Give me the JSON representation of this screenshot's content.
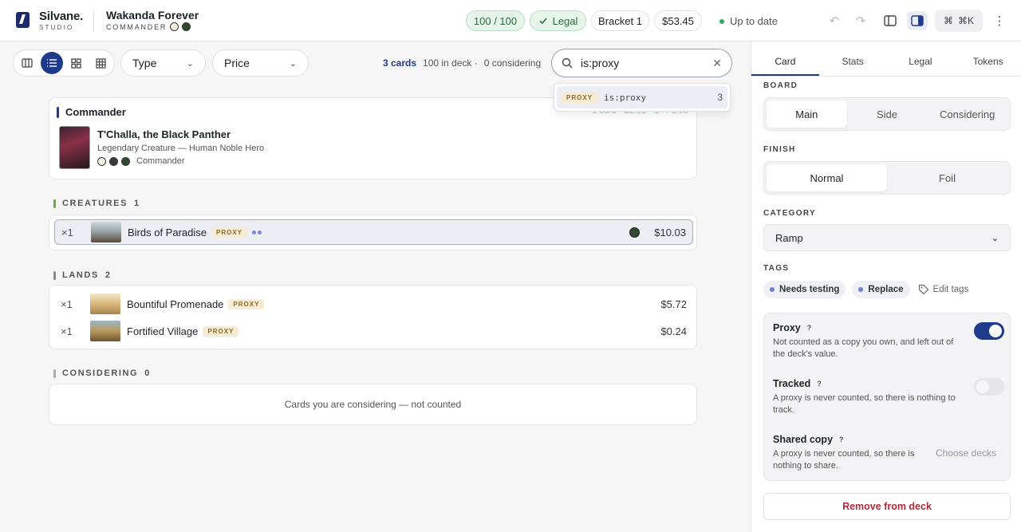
{
  "brand": {
    "name": "Silvane.",
    "sub": "STUDIO"
  },
  "deck": {
    "title": "Wakanda Forever",
    "format": "COMMANDER"
  },
  "header": {
    "count": "100 / 100",
    "legal": "Legal",
    "bracket": "Bracket 1",
    "price": "$53.45",
    "status": "Up to date",
    "shortcut": "⌘K"
  },
  "toolbar": {
    "type_label": "Type",
    "price_label": "Price",
    "cards_count": "3 cards",
    "in_deck": "100 in deck ·",
    "considering": "0 considering"
  },
  "search": {
    "value": "is:proxy",
    "suggestion": {
      "tag": "PROXY",
      "query": "is:proxy",
      "count": "3"
    }
  },
  "commander": {
    "heading": "Commander",
    "name": "T'Challa, the Black Panther",
    "type": "Legendary Creature — Human Noble Hero",
    "role": "Commander",
    "stats": "1 card · $2.01 · 1× / 1.00"
  },
  "sections": {
    "creatures": {
      "label": "CREATURES",
      "count": "1"
    },
    "lands": {
      "label": "LANDS",
      "count": "2"
    },
    "considering": {
      "label": "CONSIDERING",
      "count": "0",
      "empty": "Cards you are considering — not counted"
    }
  },
  "cards": {
    "creatures": [
      {
        "qty": "×1",
        "name": "Birds of Paradise",
        "tag": "PROXY",
        "price": "$10.03"
      }
    ],
    "lands": [
      {
        "qty": "×1",
        "name": "Bountiful Promenade",
        "tag": "PROXY",
        "price": "$5.72"
      },
      {
        "qty": "×1",
        "name": "Fortified Village",
        "tag": "PROXY",
        "price": "$0.24"
      }
    ]
  },
  "panel": {
    "tabs": [
      "Card",
      "Stats",
      "Legal",
      "Tokens"
    ],
    "board_label": "BOARD",
    "board_options": [
      "Main",
      "Side",
      "Considering"
    ],
    "finish_label": "FINISH",
    "finish_options": [
      "Normal",
      "Foil"
    ],
    "category_label": "CATEGORY",
    "category_value": "Ramp",
    "tags_label": "TAGS",
    "tags": [
      "Needs testing",
      "Replace"
    ],
    "edit_tags": "Edit tags",
    "proxy": {
      "title": "Proxy",
      "desc": "Not counted as a copy you own, and left out of the deck's value.",
      "on": true
    },
    "tracked": {
      "title": "Tracked",
      "desc": "A proxy is never counted, so there is nothing to track.",
      "on": false
    },
    "shared": {
      "title": "Shared copy",
      "desc": "A proxy is never counted, so there is nothing to share.",
      "action": "Choose decks"
    },
    "remove": "Remove from deck"
  },
  "colors": {
    "accent": "#1e3a8a",
    "legal_bg": "#e6f4ea",
    "danger": "#b32a3a",
    "proxy_tag": "#f7ebd3"
  }
}
